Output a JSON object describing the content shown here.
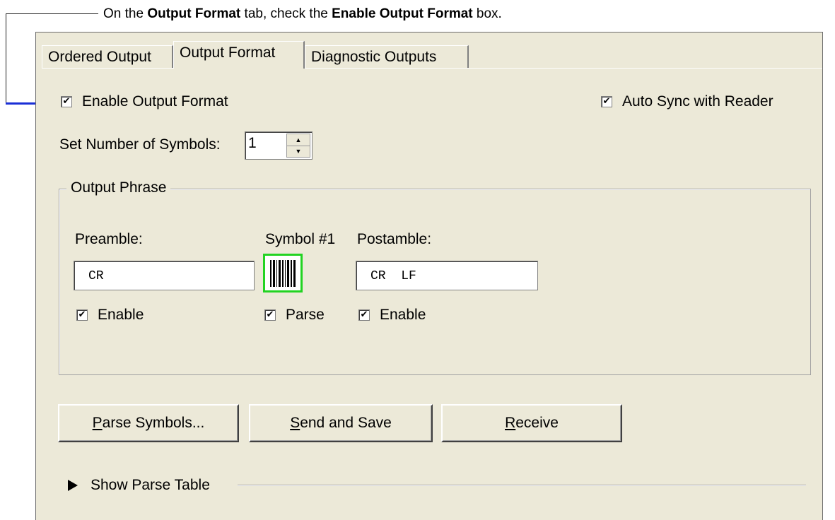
{
  "callout": {
    "text_before": "On the ",
    "bold1": "Output Format",
    "text_middle": " tab, check the ",
    "bold2": "Enable Output Format",
    "text_after": " box."
  },
  "tabs": [
    {
      "label": "Ordered Output",
      "active": false
    },
    {
      "label": "Output Format",
      "active": true
    },
    {
      "label": "Diagnostic Outputs",
      "active": false
    }
  ],
  "enable_output_format": {
    "label": "Enable Output Format",
    "checked": true
  },
  "auto_sync": {
    "label": "Auto Sync with Reader",
    "checked": true
  },
  "number_of_symbols": {
    "label": "Set Number of Symbols:",
    "value": "1"
  },
  "output_phrase": {
    "title": "Output Phrase",
    "preamble_label": "Preamble:",
    "preamble_value": "CR",
    "preamble_enable": "Enable",
    "symbol_label": "Symbol #1",
    "symbol_parse": "Parse",
    "postamble_label": "Postamble:",
    "postamble_value": "CR  LF",
    "postamble_enable": "Enable"
  },
  "buttons": {
    "parse_symbols": {
      "accel": "P",
      "rest": "arse Symbols..."
    },
    "send_and_save": {
      "accel": "S",
      "rest": "end and Save"
    },
    "receive": {
      "accel": "R",
      "rest": "eceive"
    }
  },
  "show_parse_table": "Show Parse Table",
  "colors": {
    "accent_arrow": "#1a2fd6",
    "symbol_border": "#22d322",
    "dialog_bg": "#ece9d8"
  }
}
